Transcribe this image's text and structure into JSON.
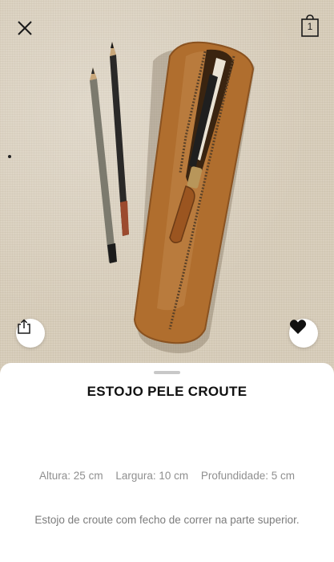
{
  "header": {
    "close_icon": "close-icon",
    "cart_icon": "shopping-bag-icon",
    "cart_count": "1"
  },
  "image": {
    "description_icons": {
      "share": "share-icon",
      "favorite": "heart-icon"
    }
  },
  "product": {
    "name": "ESTOJO PELE CROUTE",
    "dimensions": {
      "height": "Altura: 25 cm",
      "width": "Largura: 10 cm",
      "depth": "Profundidade: 5 cm"
    },
    "description": "Estojo de croute com fecho de correr na parte superior."
  },
  "colors": {
    "leather": "#b06e2e",
    "canvas": "#d9cfbd",
    "favorite": "#111111"
  }
}
